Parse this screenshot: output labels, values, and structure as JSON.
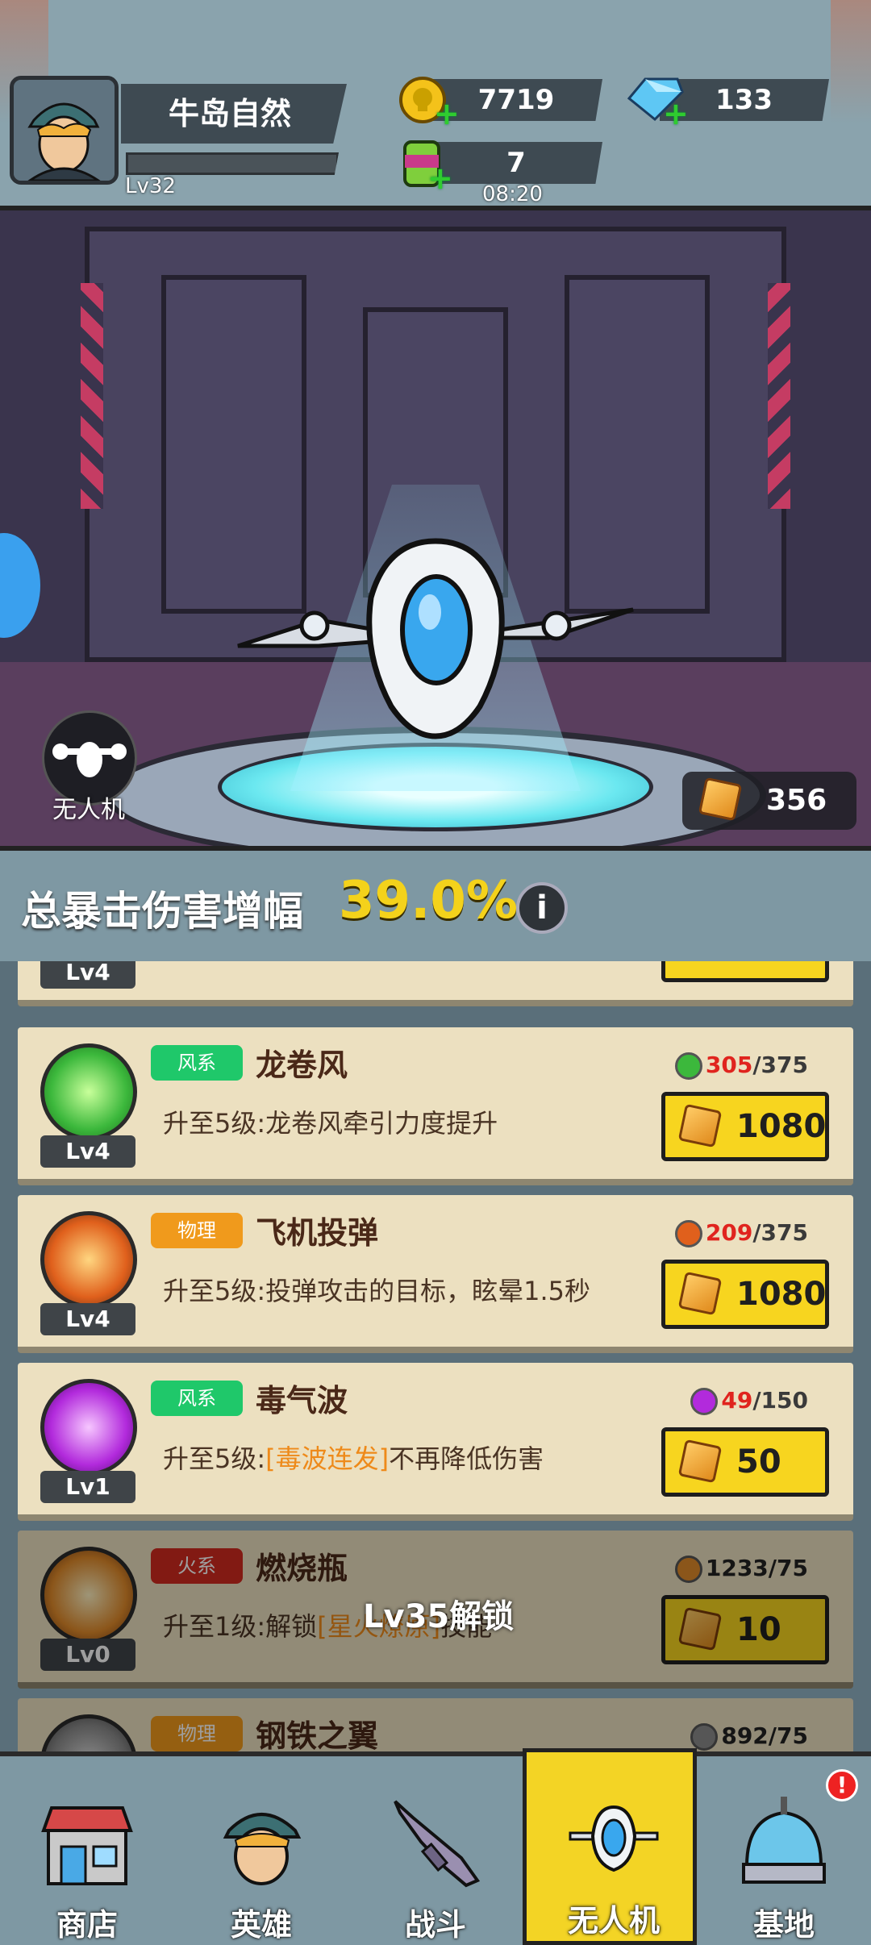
{
  "player": {
    "name": "牛岛自然",
    "level": "Lv32",
    "xp_fraction": 0.0
  },
  "resources": {
    "coins": "7719",
    "diamonds": "133",
    "energy": "7",
    "energy_timer": "08:20"
  },
  "hangar": {
    "mode_label": "无人机",
    "crystals": "356"
  },
  "stat": {
    "label": "总暴击伤害增幅",
    "value": "39.0%"
  },
  "cards": [
    {
      "level": "Lv4",
      "type": "风系",
      "type_color": "#1fc86a",
      "name": "龙卷风",
      "desc_prefix": "升至5级:龙卷风牵引力度提升",
      "desc_hl": "",
      "desc_suffix": "",
      "count_cur": "305",
      "count_max": "/375",
      "cost": "1080",
      "locked": false,
      "orb": "green"
    },
    {
      "level": "Lv4",
      "type": "物理",
      "type_color": "#f09a1c",
      "name": "飞机投弹",
      "desc_prefix": "升至5级:投弹攻击的目标，眩晕1.5秒",
      "desc_hl": "",
      "desc_suffix": "",
      "count_cur": "209",
      "count_max": "/375",
      "cost": "1080",
      "locked": false,
      "orb": "orange"
    },
    {
      "level": "Lv1",
      "type": "风系",
      "type_color": "#1fc86a",
      "name": "毒气波",
      "desc_prefix": "升至5级:",
      "desc_hl": "[毒波连发]",
      "desc_suffix": "不再降低伤害",
      "count_cur": "49",
      "count_max": "/150",
      "cost": "50",
      "locked": false,
      "orb": "purple"
    },
    {
      "level": "Lv0",
      "type": "火系",
      "type_color": "#d22a1e",
      "name": "燃烧瓶",
      "desc_prefix": "升至1级:解锁",
      "desc_hl": "[星火燎原]",
      "desc_suffix": "技能",
      "count_cur": "1233",
      "count_max": "/75",
      "cost": "10",
      "locked": true,
      "orb": "molotov"
    },
    {
      "level": "",
      "type": "物理",
      "type_color": "#f09a1c",
      "name": "钢铁之翼",
      "desc_prefix": "",
      "desc_hl": "",
      "desc_suffix": "",
      "count_cur": "892",
      "count_max": "/75",
      "cost": "",
      "locked": true,
      "orb": "steel"
    }
  ],
  "partial_top_card": {
    "level": "Lv4"
  },
  "lock_message": "Lv35解锁",
  "nav": [
    {
      "label": "商店",
      "icon": "shop-icon"
    },
    {
      "label": "英雄",
      "icon": "hero-icon"
    },
    {
      "label": "战斗",
      "icon": "rifle-icon"
    },
    {
      "label": "无人机",
      "icon": "drone-icon"
    },
    {
      "label": "基地",
      "icon": "base-dome-icon"
    }
  ],
  "nav_active": "无人机",
  "alert_badge": "!"
}
